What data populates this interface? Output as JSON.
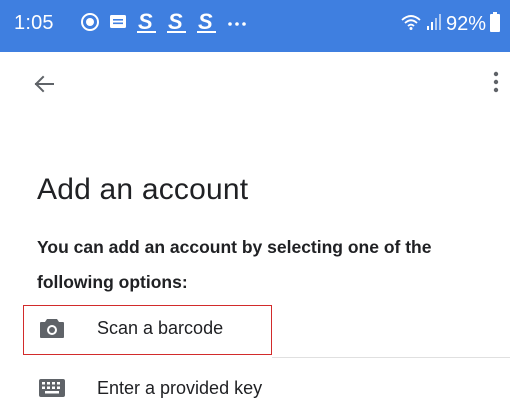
{
  "status_bar": {
    "time": "1:05",
    "battery": "92%",
    "background_color": "#3f7fe0"
  },
  "app_bar": {
    "back_icon": "arrow-back-icon",
    "overflow_icon": "more-vert-icon"
  },
  "page": {
    "title": "Add an account",
    "description": "You can add an account by selecting one of the following options:"
  },
  "options": [
    {
      "label": "Scan a barcode",
      "icon": "camera-icon"
    },
    {
      "label": "Enter a provided key",
      "icon": "keyboard-icon"
    }
  ],
  "highlight_color": "#d22b2b"
}
